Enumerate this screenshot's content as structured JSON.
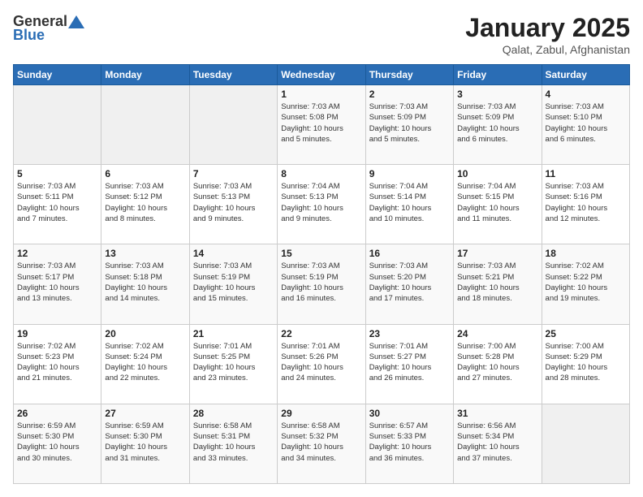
{
  "header": {
    "logo_general": "General",
    "logo_blue": "Blue",
    "title": "January 2025",
    "subtitle": "Qalat, Zabul, Afghanistan"
  },
  "weekdays": [
    "Sunday",
    "Monday",
    "Tuesday",
    "Wednesday",
    "Thursday",
    "Friday",
    "Saturday"
  ],
  "weeks": [
    [
      {
        "day": "",
        "info": ""
      },
      {
        "day": "",
        "info": ""
      },
      {
        "day": "",
        "info": ""
      },
      {
        "day": "1",
        "info": "Sunrise: 7:03 AM\nSunset: 5:08 PM\nDaylight: 10 hours\nand 5 minutes."
      },
      {
        "day": "2",
        "info": "Sunrise: 7:03 AM\nSunset: 5:09 PM\nDaylight: 10 hours\nand 5 minutes."
      },
      {
        "day": "3",
        "info": "Sunrise: 7:03 AM\nSunset: 5:09 PM\nDaylight: 10 hours\nand 6 minutes."
      },
      {
        "day": "4",
        "info": "Sunrise: 7:03 AM\nSunset: 5:10 PM\nDaylight: 10 hours\nand 6 minutes."
      }
    ],
    [
      {
        "day": "5",
        "info": "Sunrise: 7:03 AM\nSunset: 5:11 PM\nDaylight: 10 hours\nand 7 minutes."
      },
      {
        "day": "6",
        "info": "Sunrise: 7:03 AM\nSunset: 5:12 PM\nDaylight: 10 hours\nand 8 minutes."
      },
      {
        "day": "7",
        "info": "Sunrise: 7:03 AM\nSunset: 5:13 PM\nDaylight: 10 hours\nand 9 minutes."
      },
      {
        "day": "8",
        "info": "Sunrise: 7:04 AM\nSunset: 5:13 PM\nDaylight: 10 hours\nand 9 minutes."
      },
      {
        "day": "9",
        "info": "Sunrise: 7:04 AM\nSunset: 5:14 PM\nDaylight: 10 hours\nand 10 minutes."
      },
      {
        "day": "10",
        "info": "Sunrise: 7:04 AM\nSunset: 5:15 PM\nDaylight: 10 hours\nand 11 minutes."
      },
      {
        "day": "11",
        "info": "Sunrise: 7:03 AM\nSunset: 5:16 PM\nDaylight: 10 hours\nand 12 minutes."
      }
    ],
    [
      {
        "day": "12",
        "info": "Sunrise: 7:03 AM\nSunset: 5:17 PM\nDaylight: 10 hours\nand 13 minutes."
      },
      {
        "day": "13",
        "info": "Sunrise: 7:03 AM\nSunset: 5:18 PM\nDaylight: 10 hours\nand 14 minutes."
      },
      {
        "day": "14",
        "info": "Sunrise: 7:03 AM\nSunset: 5:19 PM\nDaylight: 10 hours\nand 15 minutes."
      },
      {
        "day": "15",
        "info": "Sunrise: 7:03 AM\nSunset: 5:19 PM\nDaylight: 10 hours\nand 16 minutes."
      },
      {
        "day": "16",
        "info": "Sunrise: 7:03 AM\nSunset: 5:20 PM\nDaylight: 10 hours\nand 17 minutes."
      },
      {
        "day": "17",
        "info": "Sunrise: 7:03 AM\nSunset: 5:21 PM\nDaylight: 10 hours\nand 18 minutes."
      },
      {
        "day": "18",
        "info": "Sunrise: 7:02 AM\nSunset: 5:22 PM\nDaylight: 10 hours\nand 19 minutes."
      }
    ],
    [
      {
        "day": "19",
        "info": "Sunrise: 7:02 AM\nSunset: 5:23 PM\nDaylight: 10 hours\nand 21 minutes."
      },
      {
        "day": "20",
        "info": "Sunrise: 7:02 AM\nSunset: 5:24 PM\nDaylight: 10 hours\nand 22 minutes."
      },
      {
        "day": "21",
        "info": "Sunrise: 7:01 AM\nSunset: 5:25 PM\nDaylight: 10 hours\nand 23 minutes."
      },
      {
        "day": "22",
        "info": "Sunrise: 7:01 AM\nSunset: 5:26 PM\nDaylight: 10 hours\nand 24 minutes."
      },
      {
        "day": "23",
        "info": "Sunrise: 7:01 AM\nSunset: 5:27 PM\nDaylight: 10 hours\nand 26 minutes."
      },
      {
        "day": "24",
        "info": "Sunrise: 7:00 AM\nSunset: 5:28 PM\nDaylight: 10 hours\nand 27 minutes."
      },
      {
        "day": "25",
        "info": "Sunrise: 7:00 AM\nSunset: 5:29 PM\nDaylight: 10 hours\nand 28 minutes."
      }
    ],
    [
      {
        "day": "26",
        "info": "Sunrise: 6:59 AM\nSunset: 5:30 PM\nDaylight: 10 hours\nand 30 minutes."
      },
      {
        "day": "27",
        "info": "Sunrise: 6:59 AM\nSunset: 5:30 PM\nDaylight: 10 hours\nand 31 minutes."
      },
      {
        "day": "28",
        "info": "Sunrise: 6:58 AM\nSunset: 5:31 PM\nDaylight: 10 hours\nand 33 minutes."
      },
      {
        "day": "29",
        "info": "Sunrise: 6:58 AM\nSunset: 5:32 PM\nDaylight: 10 hours\nand 34 minutes."
      },
      {
        "day": "30",
        "info": "Sunrise: 6:57 AM\nSunset: 5:33 PM\nDaylight: 10 hours\nand 36 minutes."
      },
      {
        "day": "31",
        "info": "Sunrise: 6:56 AM\nSunset: 5:34 PM\nDaylight: 10 hours\nand 37 minutes."
      },
      {
        "day": "",
        "info": ""
      }
    ]
  ]
}
